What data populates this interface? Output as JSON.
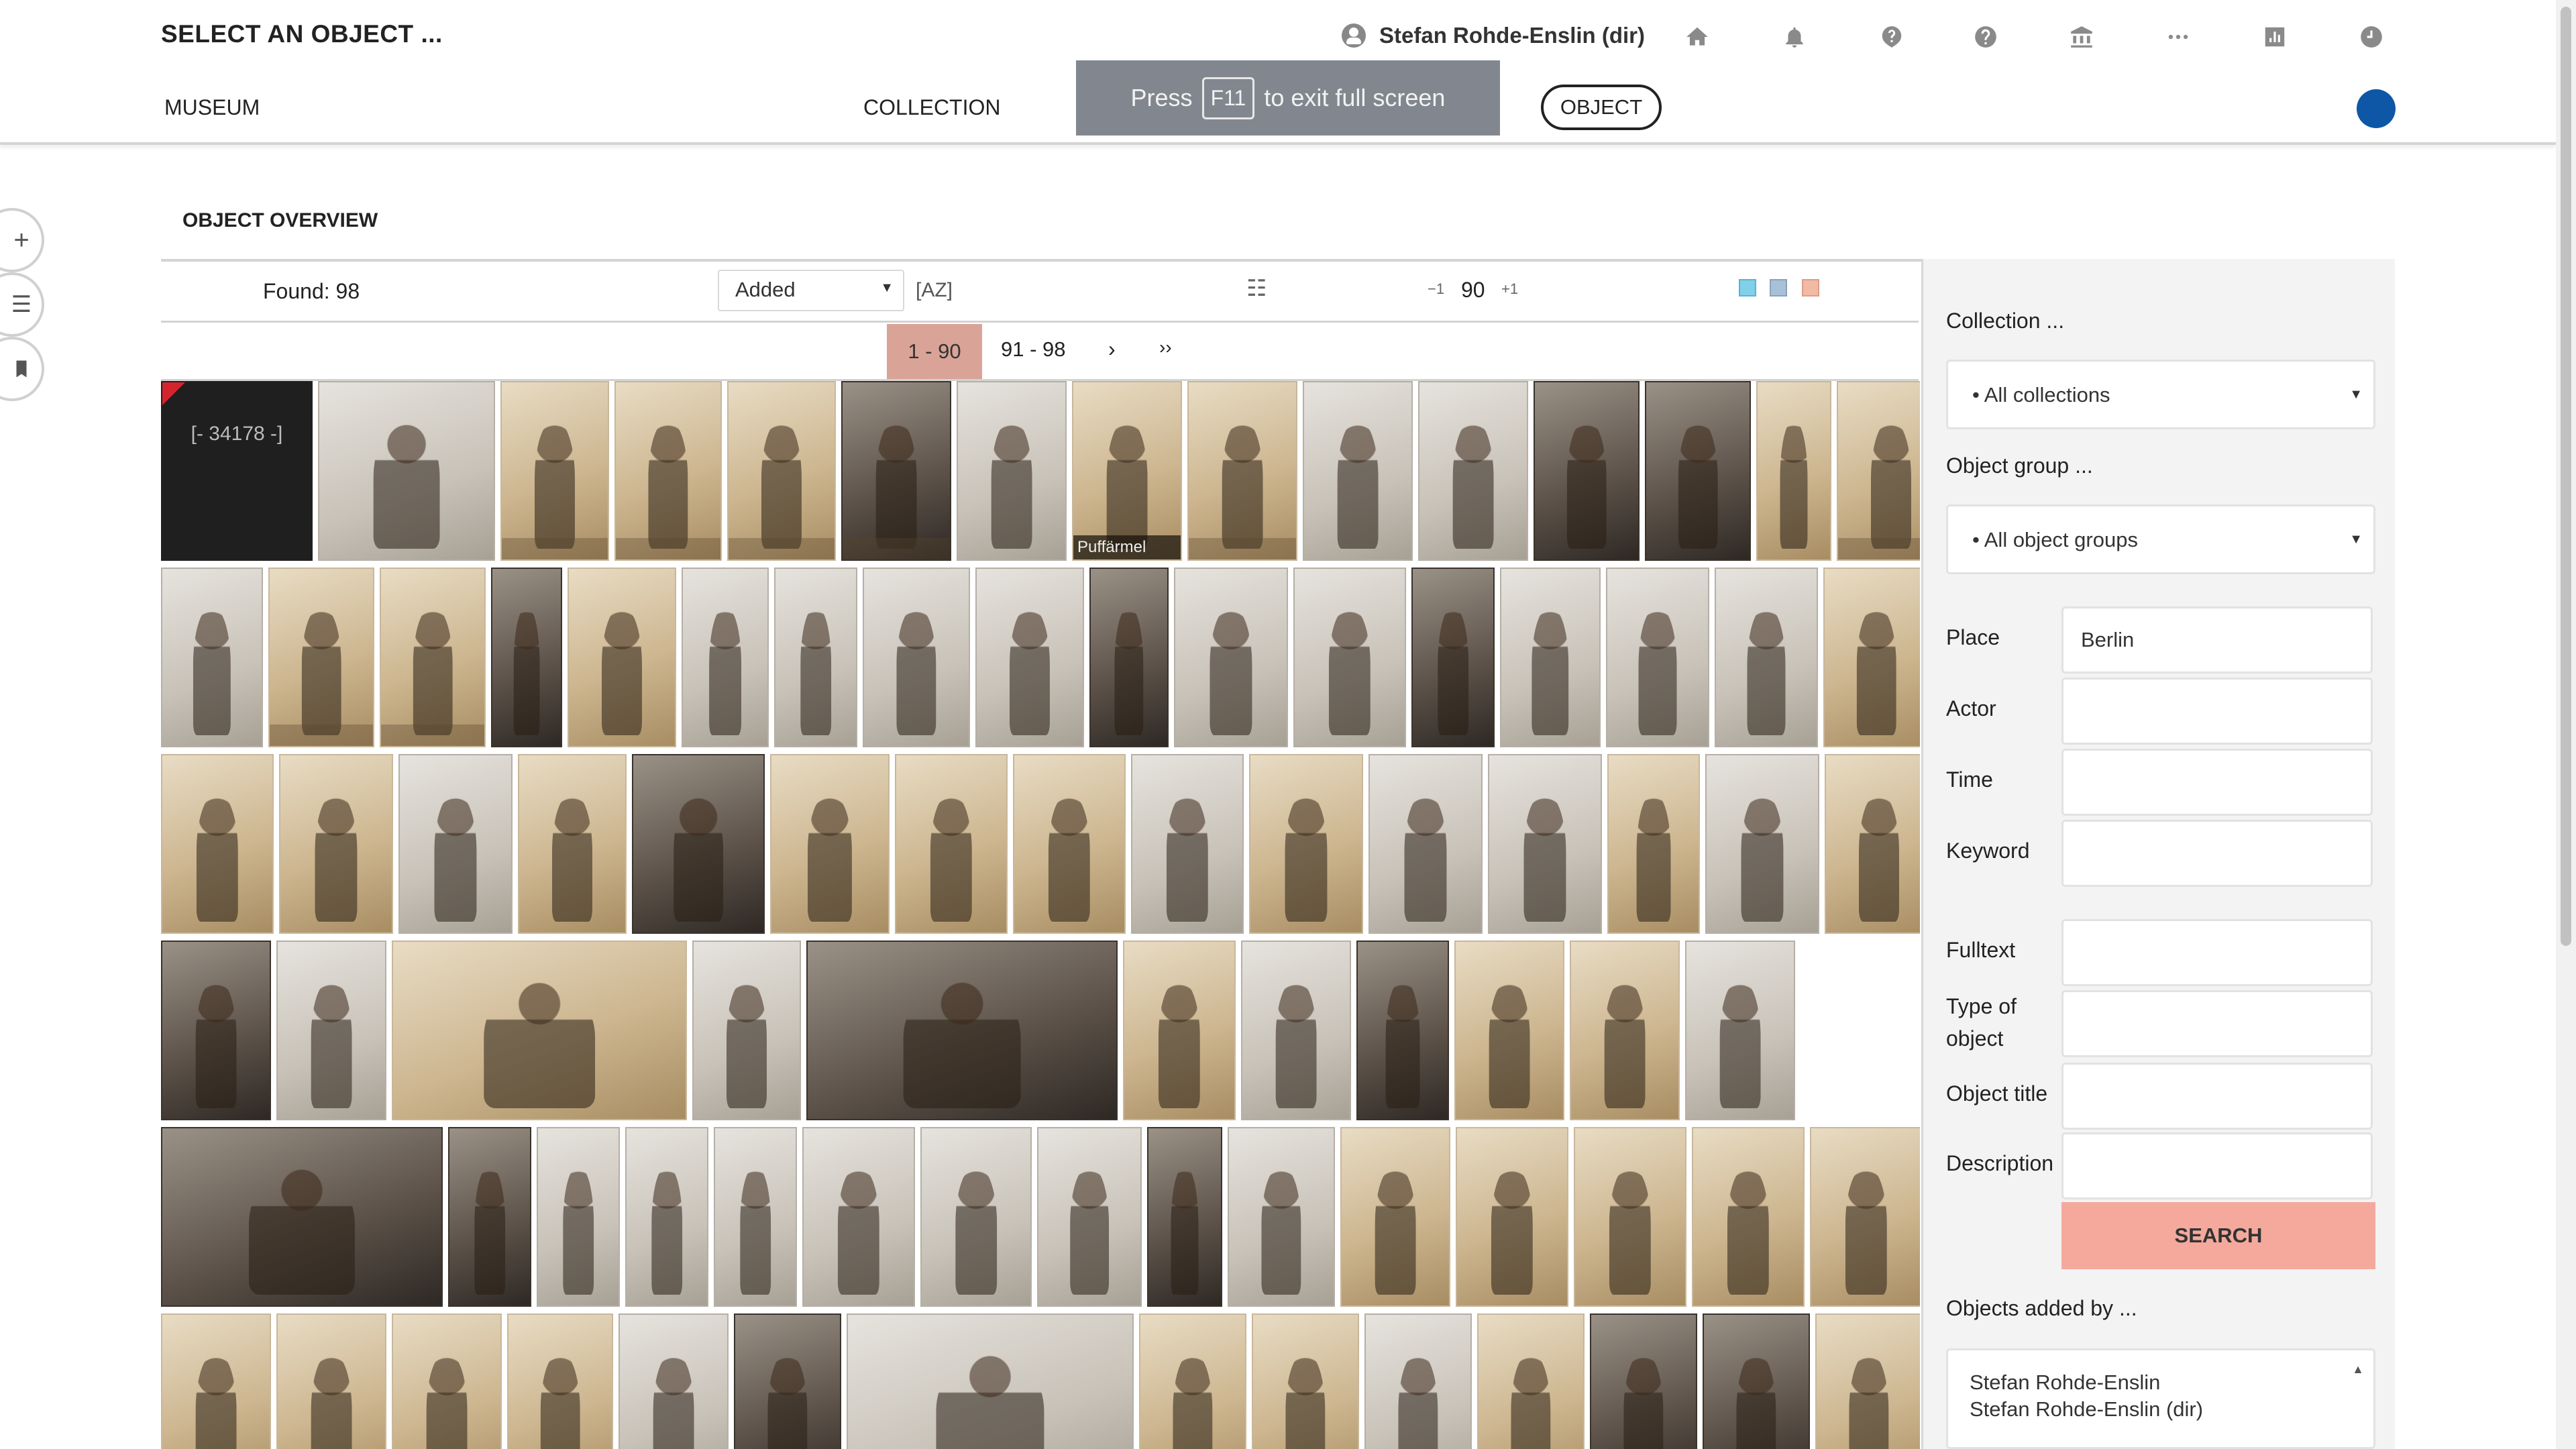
{
  "header": {
    "title": "SELECT AN OBJECT ...",
    "user_name": "Stefan Rohde-Enslin (dir)",
    "icons": [
      "home-icon",
      "bell-icon",
      "help-icon",
      "question-icon",
      "museum-icon",
      "more-icon",
      "stats-icon",
      "clock-icon"
    ]
  },
  "nav": {
    "museum": "MUSEUM",
    "collection": "COLLECTION",
    "object": "OBJECT"
  },
  "fullscreen_toast": {
    "before": "Press",
    "key": "F11",
    "after": "to exit full screen"
  },
  "section": {
    "title": "OBJECT OVERVIEW"
  },
  "toolbar": {
    "found": "Found: 98",
    "sort_value": "Added",
    "az": "[AZ]",
    "page_size_minus": "−1",
    "page_size": "90",
    "page_size_plus": "+1"
  },
  "pagination": {
    "pages": [
      "1 - 90",
      "91 - 98"
    ],
    "next": "›",
    "last": "››"
  },
  "grid": {
    "first_id": "[- 34178 -]",
    "caption_puffarmel": "Puffärmel"
  },
  "filters": {
    "collection_label": "Collection ...",
    "collection_value": "• All collections",
    "group_label": "Object group ...",
    "group_value": "• All object groups",
    "place_label": "Place",
    "place_value": "Berlin",
    "actor_label": "Actor",
    "time_label": "Time",
    "keyword_label": "Keyword",
    "fulltext_label": "Fulltext",
    "type_label_1": "Type of",
    "type_label_2": "object",
    "title_label": "Object title",
    "description_label": "Description",
    "search_button": "SEARCH",
    "added_by_label": "Objects added by ...",
    "added_by_options": [
      "Stefan Rohde-Enslin",
      "Stefan Rohde-Enslin (dir)"
    ]
  },
  "colors": {
    "accent_dot": "#0d57a6",
    "active_page": "#d9a397",
    "search_button": "#f4a99c",
    "view_blue": "#7fd0e8",
    "view_mix": "#a8c0d8",
    "view_peach": "#f2b9a4"
  }
}
